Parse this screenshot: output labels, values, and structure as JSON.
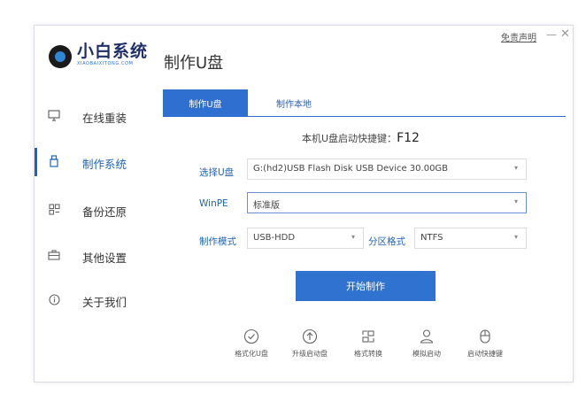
{
  "window": {
    "brand_name": "小白系统",
    "brand_sub": "XIAOBAIXITONG.COM",
    "page_title": "制作U盘",
    "disclaimer": "免责声明",
    "min_glyph": "—",
    "close_glyph": "✕"
  },
  "sidebar": {
    "items": [
      {
        "label": "在线重装",
        "icon": "monitor-icon"
      },
      {
        "label": "制作系统",
        "icon": "usb-drive-icon",
        "active": true
      },
      {
        "label": "备份还原",
        "icon": "grid-icon"
      },
      {
        "label": "其他设置",
        "icon": "briefcase-icon"
      },
      {
        "label": "关于我们",
        "icon": "info-icon"
      }
    ]
  },
  "tabs": [
    {
      "label": "制作U盘",
      "active": true
    },
    {
      "label": "制作本地",
      "active": false
    }
  ],
  "hotkey": {
    "label": "本机U盘启动快捷键：",
    "key": "F12"
  },
  "form": {
    "usb_label": "选择U盘",
    "usb_value": "G:(hd2)USB Flash Disk USB Device 30.00GB",
    "winpe_label": "WinPE",
    "winpe_value": "标准版",
    "mode_label": "制作模式",
    "mode_value": "USB-HDD",
    "partition_label": "分区格式",
    "partition_value": "NTFS",
    "arrow": "▾"
  },
  "start_button": "开始制作",
  "tools": [
    {
      "label": "格式化U盘",
      "icon": "check-circle-icon"
    },
    {
      "label": "升级启动盘",
      "icon": "upload-circle-icon"
    },
    {
      "label": "格式转换",
      "icon": "convert-icon"
    },
    {
      "label": "模拟启动",
      "icon": "user-simulate-icon"
    },
    {
      "label": "启动快捷键",
      "icon": "mouse-icon"
    }
  ],
  "colors": {
    "accent": "#2f6fd0",
    "active_text": "#1e63b8"
  }
}
